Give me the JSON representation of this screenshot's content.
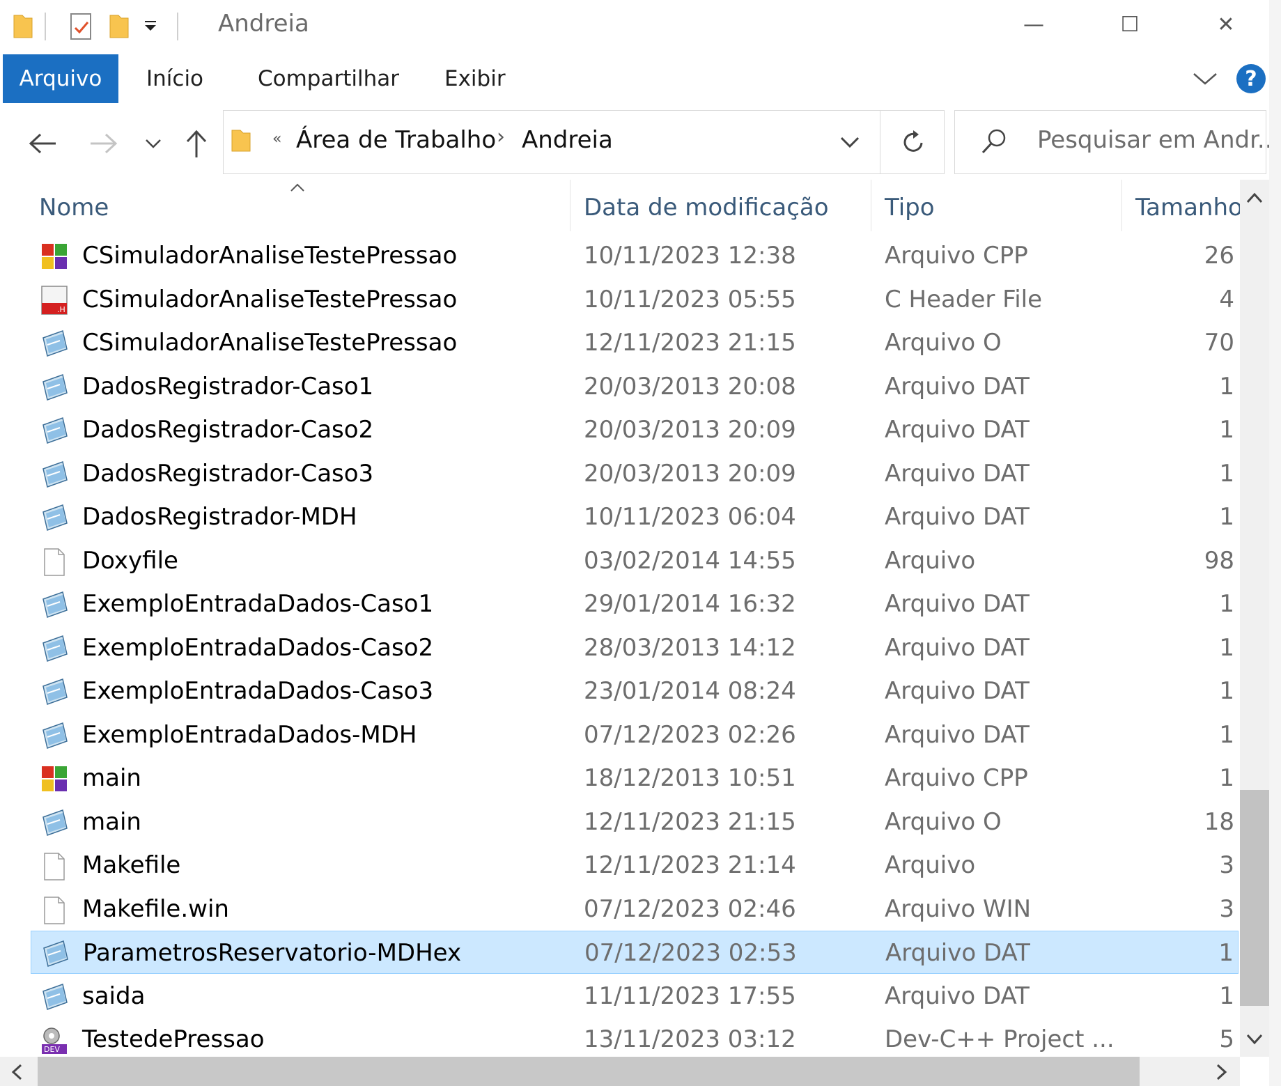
{
  "window": {
    "title": "Andreia",
    "minimize_glyph": "—",
    "maximize_glyph": "☐",
    "close_glyph": "✕"
  },
  "ribbon": {
    "tabs": [
      "Arquivo",
      "Início",
      "Compartilhar",
      "Exibir"
    ],
    "active_tab": "Arquivo",
    "help": "?"
  },
  "address": {
    "overflow": "«",
    "breadcrumb": [
      "Área de Trabalho",
      "Andreia"
    ],
    "separator": "›"
  },
  "search": {
    "placeholder": "Pesquisar em Andr..."
  },
  "columns": {
    "name": "Nome",
    "date": "Data de modificação",
    "type": "Tipo",
    "size": "Tamanho"
  },
  "files": [
    {
      "name": "CSimuladorAnaliseTestePressao",
      "date": "10/11/2023 12:38",
      "type": "Arquivo CPP",
      "size": "26",
      "icon": "cpp-file-icon",
      "selected": false
    },
    {
      "name": "CSimuladorAnaliseTestePressao",
      "date": "10/11/2023 05:55",
      "type": "C Header File",
      "size": "4",
      "icon": "header-file-icon",
      "selected": false
    },
    {
      "name": "CSimuladorAnaliseTestePressao",
      "date": "12/11/2023 21:15",
      "type": "Arquivo O",
      "size": "70",
      "icon": "data-file-icon",
      "selected": false
    },
    {
      "name": "DadosRegistrador-Caso1",
      "date": "20/03/2013 20:08",
      "type": "Arquivo DAT",
      "size": "1",
      "icon": "data-file-icon",
      "selected": false
    },
    {
      "name": "DadosRegistrador-Caso2",
      "date": "20/03/2013 20:09",
      "type": "Arquivo DAT",
      "size": "1",
      "icon": "data-file-icon",
      "selected": false
    },
    {
      "name": "DadosRegistrador-Caso3",
      "date": "20/03/2013 20:09",
      "type": "Arquivo DAT",
      "size": "1",
      "icon": "data-file-icon",
      "selected": false
    },
    {
      "name": "DadosRegistrador-MDH",
      "date": "10/11/2023 06:04",
      "type": "Arquivo DAT",
      "size": "1",
      "icon": "data-file-icon",
      "selected": false
    },
    {
      "name": "Doxyfile",
      "date": "03/02/2014 14:55",
      "type": "Arquivo",
      "size": "98",
      "icon": "blank-file-icon",
      "selected": false
    },
    {
      "name": "ExemploEntradaDados-Caso1",
      "date": "29/01/2014 16:32",
      "type": "Arquivo DAT",
      "size": "1",
      "icon": "data-file-icon",
      "selected": false
    },
    {
      "name": "ExemploEntradaDados-Caso2",
      "date": "28/03/2013 14:12",
      "type": "Arquivo DAT",
      "size": "1",
      "icon": "data-file-icon",
      "selected": false
    },
    {
      "name": "ExemploEntradaDados-Caso3",
      "date": "23/01/2014 08:24",
      "type": "Arquivo DAT",
      "size": "1",
      "icon": "data-file-icon",
      "selected": false
    },
    {
      "name": "ExemploEntradaDados-MDH",
      "date": "07/12/2023 02:26",
      "type": "Arquivo DAT",
      "size": "1",
      "icon": "data-file-icon",
      "selected": false
    },
    {
      "name": "main",
      "date": "18/12/2013 10:51",
      "type": "Arquivo CPP",
      "size": "1",
      "icon": "cpp-file-icon",
      "selected": false
    },
    {
      "name": "main",
      "date": "12/11/2023 21:15",
      "type": "Arquivo O",
      "size": "18",
      "icon": "data-file-icon",
      "selected": false
    },
    {
      "name": "Makefile",
      "date": "12/11/2023 21:14",
      "type": "Arquivo",
      "size": "3",
      "icon": "blank-file-icon",
      "selected": false
    },
    {
      "name": "Makefile.win",
      "date": "07/12/2023 02:46",
      "type": "Arquivo WIN",
      "size": "3",
      "icon": "blank-file-icon",
      "selected": false
    },
    {
      "name": "ParametrosReservatorio-MDHex",
      "date": "07/12/2023 02:53",
      "type": "Arquivo DAT",
      "size": "1",
      "icon": "data-file-icon",
      "selected": true
    },
    {
      "name": "saida",
      "date": "11/11/2023 17:55",
      "type": "Arquivo DAT",
      "size": "1",
      "icon": "data-file-icon",
      "selected": false
    },
    {
      "name": "TestedePressao",
      "date": "13/11/2023 03:12",
      "type": "Dev-C++ Project ...",
      "size": "5",
      "icon": "devcpp-project-icon",
      "selected": false
    }
  ],
  "colors": {
    "accent": "#1b6fc2",
    "selection": "#cce8ff",
    "folder": "#f8c44f"
  }
}
